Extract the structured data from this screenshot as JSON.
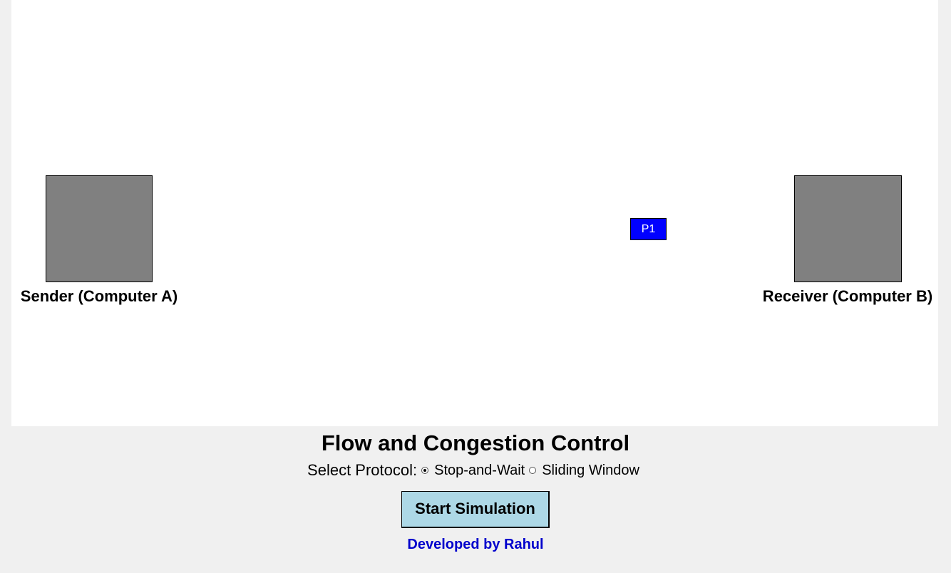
{
  "simulation": {
    "sender": {
      "label": "Sender (Computer A)",
      "color": "#808080"
    },
    "receiver": {
      "label": "Receiver (Computer B)",
      "color": "#808080"
    },
    "packets": [
      {
        "label": "P1",
        "color": "#0000ff"
      }
    ]
  },
  "controls": {
    "title": "Flow and Congestion Control",
    "protocol_label": "Select Protocol:",
    "protocol_options": [
      {
        "label": "Stop-and-Wait",
        "selected": true
      },
      {
        "label": "Sliding Window",
        "selected": false
      }
    ],
    "start_button_label": "Start Simulation",
    "start_button_color": "#add8e6",
    "credit": "Developed by Rahul",
    "credit_color": "#0000cc"
  }
}
